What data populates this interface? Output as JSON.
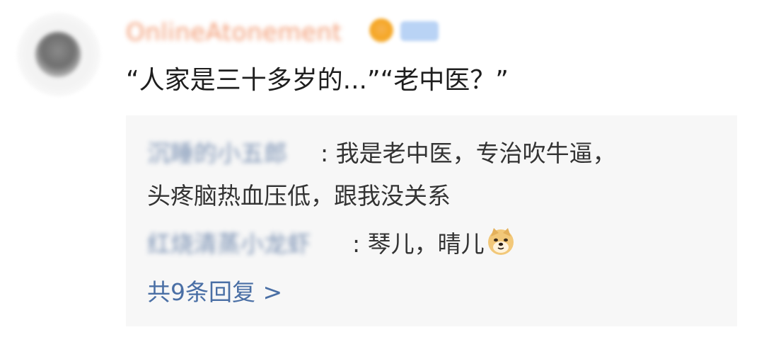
{
  "comment": {
    "username": "OnlineAtonement",
    "text": "“人家是三十多岁的...”“老中医？”"
  },
  "replies": [
    {
      "author": "沉睡的小五郎",
      "body": ": 我是老中医，专治吹牛逼，",
      "body_line2": "头疼脑热血压低，跟我没关系"
    },
    {
      "author": "红烧清蒸小龙虾",
      "body": ": 琴儿，晴儿"
    }
  ],
  "more_replies_label": "共9条回复 >",
  "icons": {
    "avatar": "avatar",
    "crown": "crown-badge-icon",
    "level": "level-badge-icon",
    "emoji": "doge-emoji-icon"
  },
  "colors": {
    "username": "#f08a5c",
    "link": "#4a6fa5",
    "reply_box_bg": "#f7f7f7"
  }
}
